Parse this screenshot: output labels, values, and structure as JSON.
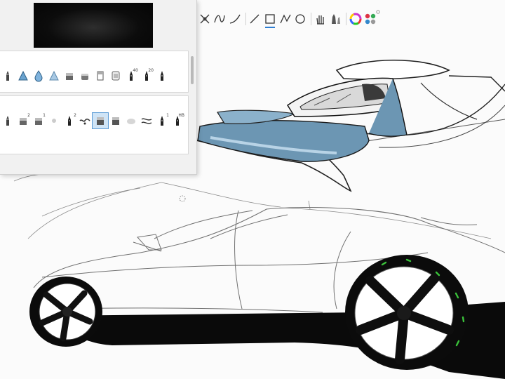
{
  "app": {
    "accent": "#2e7fd4",
    "paper_color": "#fbfbfb",
    "shade_color": "#6c96b3"
  },
  "toolbar": {
    "tools": [
      {
        "icon": "transform-icon",
        "active": false
      },
      {
        "icon": "freehand-curve-icon",
        "active": false
      },
      {
        "icon": "french-curve-icon",
        "active": false
      },
      {
        "icon": "line-icon",
        "active": false
      },
      {
        "icon": "rectangle-icon",
        "active": true
      },
      {
        "icon": "polyline-icon",
        "active": false
      },
      {
        "icon": "ellipse-icon",
        "active": false
      },
      {
        "icon": "hand-icon",
        "active": false
      },
      {
        "icon": "brush-properties-icon",
        "active": false
      },
      {
        "icon": "color-wheel-icon",
        "active": false
      },
      {
        "icon": "copic-library-icon",
        "active": false
      }
    ]
  },
  "brush_panel": {
    "set_1": {
      "brushes": [
        {
          "icon": "pencil-brush-icon",
          "size_label": ""
        },
        {
          "icon": "airbrush-hard-icon",
          "size_label": ""
        },
        {
          "icon": "water-drop-brush-icon",
          "size_label": ""
        },
        {
          "icon": "airbrush-soft-icon",
          "size_label": ""
        },
        {
          "icon": "marker-chisel-icon",
          "size_label": ""
        },
        {
          "icon": "marker-round-icon",
          "size_label": ""
        },
        {
          "icon": "eraser-hard-icon",
          "size_label": ""
        },
        {
          "icon": "eraser-soft-icon",
          "size_label": ""
        },
        {
          "icon": "ink-pen-icon",
          "size_label": "40"
        },
        {
          "icon": "ink-pen-icon",
          "size_label": "20"
        },
        {
          "icon": "ink-pen-icon",
          "size_label": ""
        }
      ]
    },
    "set_2": {
      "brushes": [
        {
          "icon": "pencil-brush-icon",
          "size_label": ""
        },
        {
          "icon": "marker-chisel-icon",
          "size_label": "2"
        },
        {
          "icon": "marker-chisel-icon",
          "size_label": "1"
        },
        {
          "icon": "dot-brush-icon",
          "size_label": ""
        },
        {
          "icon": "ink-pen-icon",
          "size_label": "2"
        },
        {
          "icon": "smudge-brush-icon",
          "size_label": ""
        },
        {
          "icon": "marker-square-icon",
          "size_label": "",
          "selected": true
        },
        {
          "icon": "marker-square-icon",
          "size_label": ""
        },
        {
          "icon": "blur-brush-icon",
          "size_label": ""
        },
        {
          "icon": "smear-brush-icon",
          "size_label": ""
        },
        {
          "icon": "ink-pen-icon",
          "size_label": "1"
        },
        {
          "icon": "ink-pen-icon",
          "size_label": "HB"
        }
      ]
    }
  }
}
